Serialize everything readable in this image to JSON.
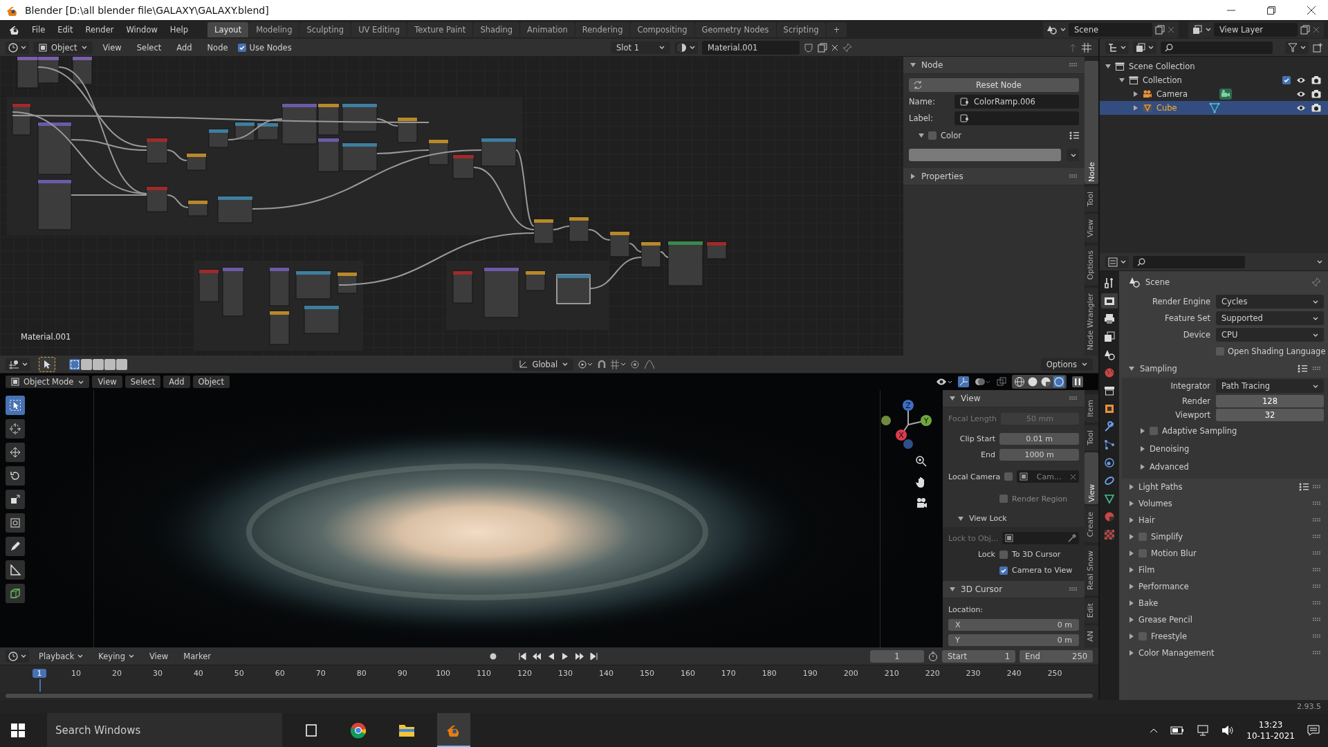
{
  "window": {
    "title": "Blender [D:\\all blender file\\GALAXY\\GALAXY.blend]"
  },
  "menu": [
    "File",
    "Edit",
    "Render",
    "Window",
    "Help"
  ],
  "workspaces": [
    {
      "label": "Layout",
      "selected": true
    },
    {
      "label": "Modeling",
      "selected": false
    },
    {
      "label": "Sculpting",
      "selected": false
    },
    {
      "label": "UV Editing",
      "selected": false
    },
    {
      "label": "Texture Paint",
      "selected": false
    },
    {
      "label": "Shading",
      "selected": false
    },
    {
      "label": "Animation",
      "selected": false
    },
    {
      "label": "Rendering",
      "selected": false
    },
    {
      "label": "Compositing",
      "selected": false
    },
    {
      "label": "Geometry Nodes",
      "selected": false
    },
    {
      "label": "Scripting",
      "selected": false
    }
  ],
  "add_workspace": "+",
  "scene": "Scene",
  "view_layer": "View Layer",
  "node_editor": {
    "mode": "Object",
    "menus": [
      "View",
      "Select",
      "Add",
      "Node"
    ],
    "use_nodes": {
      "label": "Use Nodes",
      "checked": true
    },
    "slot": "Slot 1",
    "material": "Material.001",
    "corner_label": "Material.001",
    "sidebar": {
      "tabs": [
        {
          "label": "Node",
          "selected": true
        },
        {
          "label": "Tool",
          "selected": false
        },
        {
          "label": "View",
          "selected": false
        },
        {
          "label": "Options",
          "selected": false
        },
        {
          "label": "Node Wrangler",
          "selected": false
        }
      ],
      "panel": "Node",
      "reset": "Reset Node",
      "name_label": "Name:",
      "name": "ColorRamp.006",
      "label_label": "Label:",
      "color": {
        "label": "Color",
        "checked": false
      },
      "properties": "Properties"
    }
  },
  "outliner": {
    "tree": [
      {
        "label": "Scene Collection",
        "kind": "scene_collection",
        "children": [
          {
            "label": "Collection",
            "kind": "collection",
            "checked": true,
            "children": [
              {
                "label": "Camera",
                "kind": "camera",
                "selected": false
              },
              {
                "label": "Cube",
                "kind": "mesh",
                "selected": true
              }
            ]
          }
        ]
      }
    ]
  },
  "viewport": {
    "mode": "Object Mode",
    "menus": [
      "View",
      "Select",
      "Add",
      "Object"
    ],
    "orientation": "Global",
    "options": "Options",
    "gizmo": [
      "X",
      "Y",
      "Z"
    ],
    "sidebar": {
      "tabs": [
        {
          "label": "Item",
          "selected": false
        },
        {
          "label": "Tool",
          "selected": false
        },
        {
          "label": "View",
          "selected": true
        },
        {
          "label": "Create",
          "selected": false
        },
        {
          "label": "Real Snow",
          "selected": false
        },
        {
          "label": "Edit",
          "selected": false
        },
        {
          "label": "AN",
          "selected": false
        }
      ],
      "view_panel": "View",
      "focal": {
        "label": "Focal Length",
        "value": "50 mm"
      },
      "clip": [
        {
          "label": "Clip Start",
          "value": "0.01 m"
        },
        {
          "label": "End",
          "value": "1000 m"
        }
      ],
      "local_camera": {
        "label": "Local Camera",
        "checked": false,
        "value": "Cam..."
      },
      "render_region": {
        "label": "Render Region",
        "checked": false
      },
      "view_lock": "View Lock",
      "lock_to": "Lock to Obj...",
      "lock": "Lock",
      "lock_options": [
        {
          "label": "To 3D Cursor",
          "checked": false
        },
        {
          "label": "Camera to View",
          "checked": true
        }
      ],
      "cursor_panel": "3D Cursor",
      "location": "Location:",
      "coords": [
        {
          "axis": "X",
          "value": "0 m"
        },
        {
          "axis": "Y",
          "value": "0 m"
        }
      ]
    }
  },
  "properties": {
    "title": "Scene",
    "tabs": [
      {
        "kind": "tool",
        "selected": false
      },
      {
        "kind": "render",
        "selected": true
      },
      {
        "kind": "output",
        "selected": false
      },
      {
        "kind": "view_layer",
        "selected": false
      },
      {
        "kind": "scene",
        "selected": false
      },
      {
        "kind": "world",
        "selected": false
      },
      {
        "kind": "collection",
        "selected": false
      },
      {
        "kind": "object",
        "selected": false
      },
      {
        "kind": "modifier",
        "selected": false
      },
      {
        "kind": "particles",
        "selected": false
      },
      {
        "kind": "physics",
        "selected": false
      },
      {
        "kind": "constraints",
        "selected": false
      },
      {
        "kind": "data",
        "selected": false
      },
      {
        "kind": "material",
        "selected": false
      },
      {
        "kind": "texture",
        "selected": false
      }
    ],
    "settings": [
      {
        "label": "Render Engine",
        "value": "Cycles"
      },
      {
        "label": "Feature Set",
        "value": "Supported"
      },
      {
        "label": "Device",
        "value": "CPU"
      }
    ],
    "osl": {
      "label": "Open Shading Language",
      "checked": false
    },
    "sampling": {
      "label": "Sampling",
      "integrator": {
        "label": "Integrator",
        "value": "Path Tracing"
      },
      "samples": [
        {
          "label": "Render",
          "value": "128"
        },
        {
          "label": "Viewport",
          "value": "32"
        }
      ],
      "subpanels": [
        {
          "label": "Adaptive Sampling",
          "kind": "checkbox",
          "checked": false
        },
        {
          "label": "Denoising",
          "kind": "plain"
        },
        {
          "label": "Advanced",
          "kind": "plain"
        }
      ]
    },
    "panels": [
      {
        "label": "Light Paths",
        "kind": "presets"
      },
      {
        "label": "Volumes",
        "kind": "plain"
      },
      {
        "label": "Hair",
        "kind": "plain"
      },
      {
        "label": "Simplify",
        "kind": "checkbox",
        "checked": false
      },
      {
        "label": "Motion Blur",
        "kind": "checkbox",
        "checked": false
      },
      {
        "label": "Film",
        "kind": "plain"
      },
      {
        "label": "Performance",
        "kind": "plain"
      },
      {
        "label": "Bake",
        "kind": "plain"
      },
      {
        "label": "Grease Pencil",
        "kind": "plain"
      },
      {
        "label": "Freestyle",
        "kind": "checkbox",
        "checked": false
      },
      {
        "label": "Color Management",
        "kind": "plain"
      }
    ]
  },
  "timeline": {
    "menus": [
      "Playback",
      "Keying",
      "View",
      "Marker"
    ],
    "current_frame": "1",
    "start_label": "Start",
    "start": "1",
    "end_label": "End",
    "end": "250",
    "ruler": [
      {
        "label": "1",
        "selected": true
      },
      {
        "label": "10",
        "selected": false
      },
      {
        "label": "20",
        "selected": false
      },
      {
        "label": "30",
        "selected": false
      },
      {
        "label": "40",
        "selected": false
      },
      {
        "label": "50",
        "selected": false
      },
      {
        "label": "60",
        "selected": false
      },
      {
        "label": "70",
        "selected": false
      },
      {
        "label": "80",
        "selected": false
      },
      {
        "label": "90",
        "selected": false
      },
      {
        "label": "100",
        "selected": false
      },
      {
        "label": "110",
        "selected": false
      },
      {
        "label": "120",
        "selected": false
      },
      {
        "label": "130",
        "selected": false
      },
      {
        "label": "140",
        "selected": false
      },
      {
        "label": "150",
        "selected": false
      },
      {
        "label": "160",
        "selected": false
      },
      {
        "label": "170",
        "selected": false
      },
      {
        "label": "180",
        "selected": false
      },
      {
        "label": "190",
        "selected": false
      },
      {
        "label": "200",
        "selected": false
      },
      {
        "label": "210",
        "selected": false
      },
      {
        "label": "220",
        "selected": false
      },
      {
        "label": "230",
        "selected": false
      },
      {
        "label": "240",
        "selected": false
      },
      {
        "label": "250",
        "selected": false
      }
    ]
  },
  "status_bar": {
    "version": "2.93.5"
  },
  "taskbar": {
    "search": "Search Windows",
    "time": "13:23",
    "date": "10-11-2021"
  }
}
